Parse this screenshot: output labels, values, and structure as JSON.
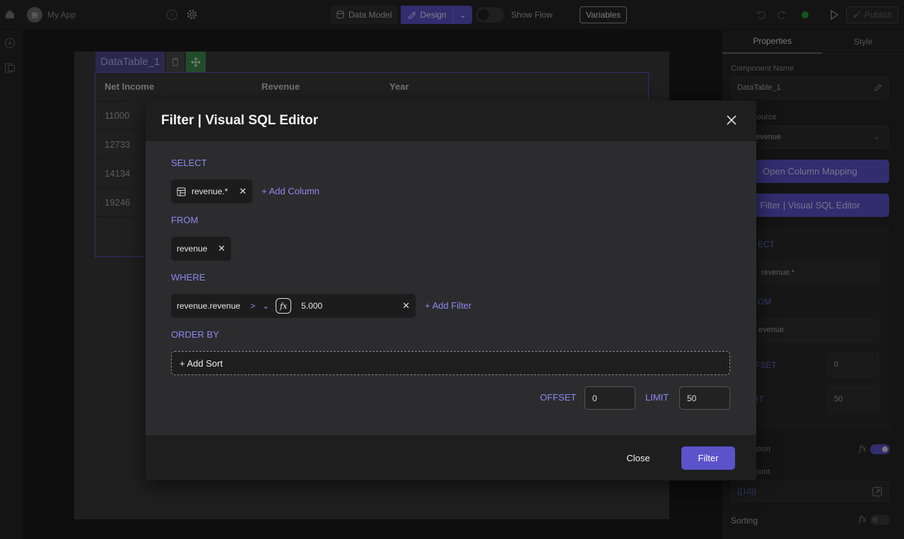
{
  "topbar": {
    "app_name": "My App",
    "app_icon_glyph": "⊞",
    "data_model_label": "Data Model",
    "design_label": "Design",
    "show_flow_label": "Show Flow",
    "variables_label": "Variables",
    "publish_label": "Publish",
    "status_color": "#1f9d3a"
  },
  "datatable": {
    "name": "DataTable_1",
    "columns": [
      "Net Income",
      "Revenue",
      "Year"
    ],
    "rows": [
      [
        "11000",
        "",
        ""
      ],
      [
        "12733",
        "",
        ""
      ],
      [
        "14134",
        "",
        ""
      ],
      [
        "19246",
        "",
        ""
      ]
    ]
  },
  "right_panel": {
    "tabs": [
      "Properties",
      "Style"
    ],
    "component_name_label": "Component Name",
    "component_name_value": "DataTable_1",
    "source_label": "ource",
    "source_value": "evenue",
    "open_column_mapping_label": "Open Column Mapping",
    "filter_btn_label": "Filter | Visual SQL Editor",
    "select_kw": "ECT",
    "select_value": "revenue.*",
    "from_kw": "OM",
    "from_value": "evenue",
    "offset_kw": "FSET",
    "offset_value": "0",
    "limit_kw": "IT",
    "limit_value": "50",
    "pagination_label": "ation",
    "count_label": "ount",
    "count_value": "{{10}}",
    "sorting_label": "Sorting"
  },
  "modal": {
    "title": "Filter | Visual SQL Editor",
    "select_label": "SELECT",
    "select_column": "revenue.*",
    "add_column_label": "+ Add Column",
    "from_label": "FROM",
    "from_table": "revenue",
    "where_label": "WHERE",
    "where_field": "revenue.revenue",
    "where_operator": ">",
    "where_value": "5.000",
    "add_filter_label": "+ Add Filter",
    "order_by_label": "ORDER BY",
    "add_sort_label": "+ Add Sort",
    "offset_label": "OFFSET",
    "offset_value": "0",
    "limit_label": "LIMIT",
    "limit_value": "50",
    "close_label": "Close",
    "filter_label": "Filter"
  },
  "colors": {
    "accent": "#5b53c9",
    "accent_text": "#8e88ee",
    "modal_bg": "#2c2c2e",
    "modal_header": "#1e1e1f"
  }
}
